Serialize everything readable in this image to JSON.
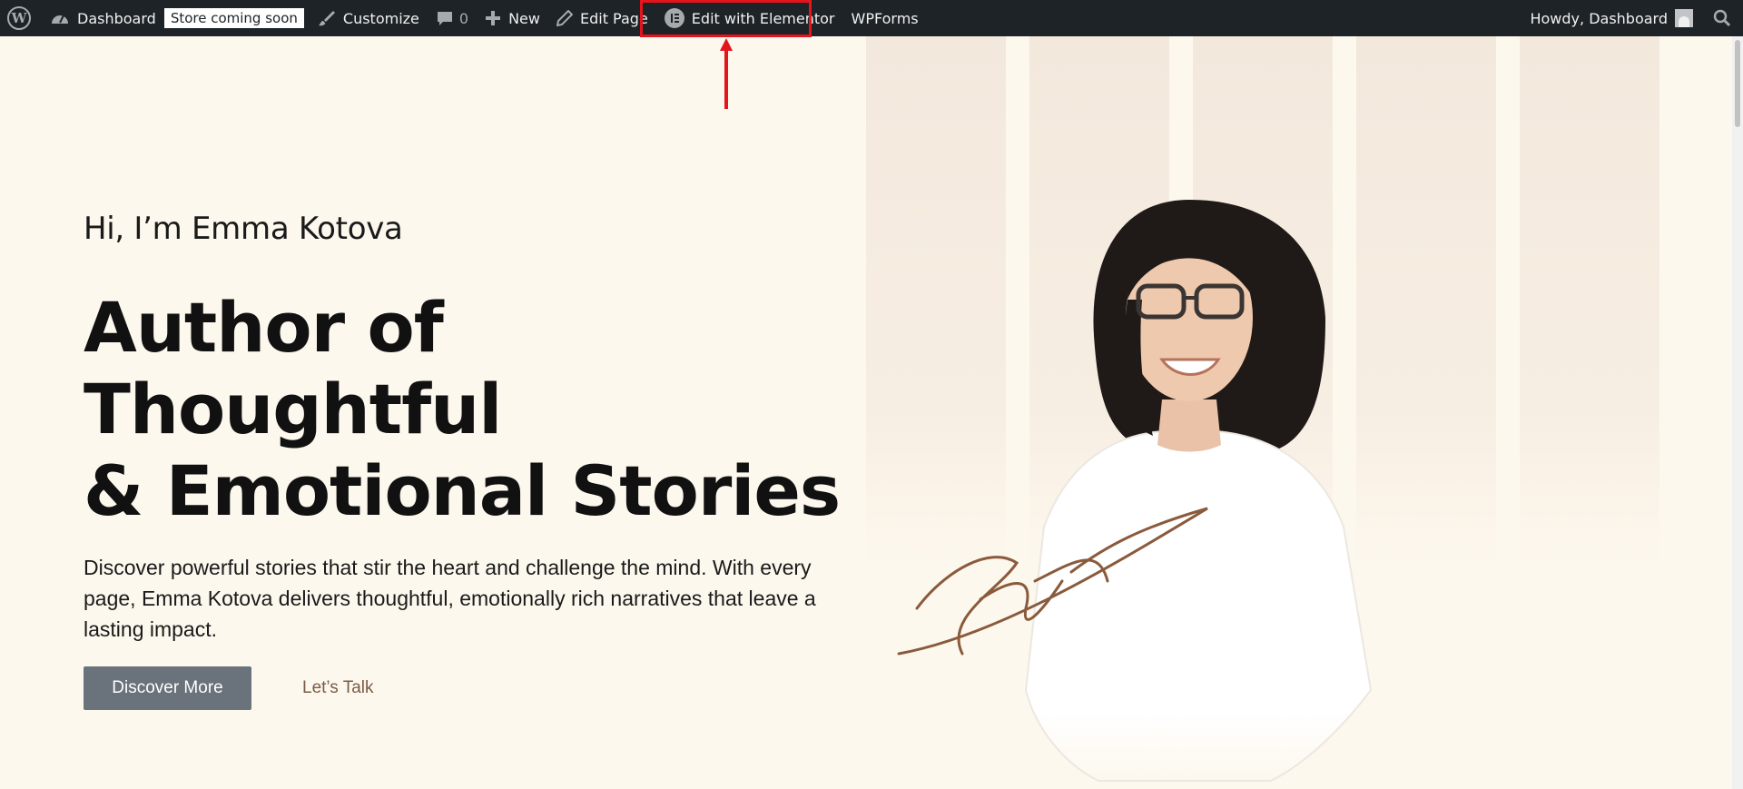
{
  "adminbar": {
    "dashboard_label": "Dashboard",
    "store_badge": "Store coming soon",
    "customize_label": "Customize",
    "comments_count": "0",
    "new_label": "New",
    "edit_page_label": "Edit Page",
    "elementor_label": "Edit with Elementor",
    "wpforms_label": "WPForms",
    "howdy_label": "Howdy, Dashboard",
    "icons": [
      "wordpress-logo-icon",
      "dashboard-icon",
      "customize-brush-icon",
      "comment-icon",
      "plus-icon",
      "pencil-icon",
      "elementor-icon",
      "avatar",
      "search-icon"
    ]
  },
  "annotation": {
    "highlight_color": "#e4151c"
  },
  "hero": {
    "greeting": "Hi, I’m Emma Kotova",
    "headline_line1": "Author of Thoughtful",
    "headline_line2": "& Emotional Stories",
    "description": "Discover powerful stories that stir the heart and challenge the mind. With every page, Emma Kotova delivers thoughtful, emotionally rich narratives that leave a lasting impact.",
    "primary_button": "Discover More",
    "secondary_link": "Let’s Talk"
  },
  "colors": {
    "background": "#fdf8ee",
    "adminbar": "#1d2327",
    "button": "#6a737b",
    "link": "#7a5b45"
  }
}
